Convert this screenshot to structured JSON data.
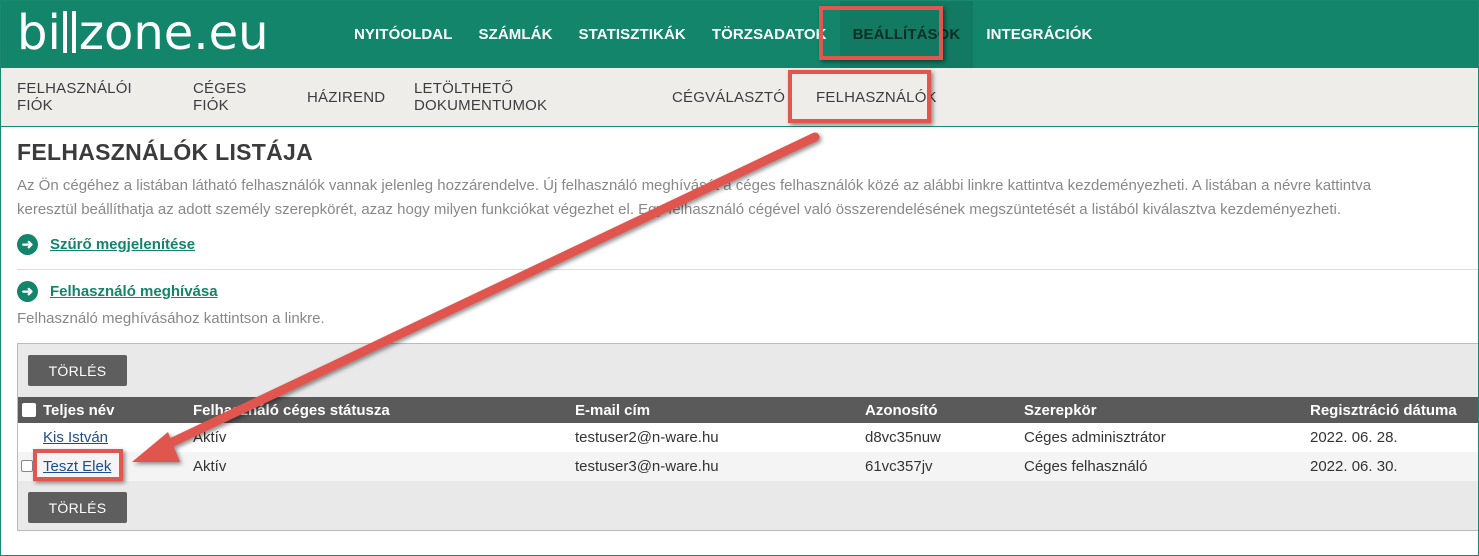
{
  "logo": {
    "text_a": "bi",
    "text_b": "zone.eu"
  },
  "top_nav": [
    {
      "label": "NYITÓOLDAL"
    },
    {
      "label": "SZÁMLÁK"
    },
    {
      "label": "STATISZTIKÁK"
    },
    {
      "label": "TÖRZSADATOK"
    },
    {
      "label": "BEÁLLÍTÁSOK"
    },
    {
      "label": "INTEGRÁCIÓK"
    }
  ],
  "sub_nav": [
    {
      "label": "FELHASZNÁLÓI FIÓK"
    },
    {
      "label": "CÉGES FIÓK"
    },
    {
      "label": "HÁZIREND"
    },
    {
      "label": "LETÖLTHETŐ DOKUMENTUMOK"
    },
    {
      "label": "CÉGVÁLASZTÓ"
    },
    {
      "label": "FELHASZNÁLÓK"
    }
  ],
  "page": {
    "title": "FELHASZNÁLÓK LISTÁJA",
    "desc_line1": "Az Ön cégéhez a listában látható felhasználók vannak jelenleg hozzárendelve. Új felhasználó meghívását a céges felhasználók közé az alábbi linkre kattintva kezdeményezheti. A listában a névre kattintva",
    "desc_line2": "keresztül beállíthatja az adott személy szerepkörét, azaz hogy milyen funkciókat végezhet el. Egy felhasználó cégével való összerendelésének megszüntetését a listából kiválasztva kezdeményezheti.",
    "filter_link": "Szűrő megjelenítése",
    "invite_link": "Felhasználó meghívása",
    "invite_hint": "Felhasználó meghívásához kattintson a linkre."
  },
  "table": {
    "delete_label": "TÖRLÉS",
    "columns": [
      "Teljes név",
      "Felhasználó céges státusza",
      "E-mail cím",
      "Azonosító",
      "Szerepkör",
      "Regisztráció dátuma"
    ],
    "rows": [
      {
        "name": "Kis István",
        "status": "Aktív",
        "email": "testuser2@n-ware.hu",
        "id": "d8vc35nuw",
        "role": "Céges adminisztrátor",
        "date": "2022. 06. 28."
      },
      {
        "name": "Teszt Elek",
        "status": "Aktív",
        "email": "testuser3@n-ware.hu",
        "id": "61vc357jv",
        "role": "Céges felhasználó",
        "date": "2022. 06. 30."
      }
    ]
  },
  "colors": {
    "brand": "#12856a",
    "highlight": "#e05750"
  }
}
